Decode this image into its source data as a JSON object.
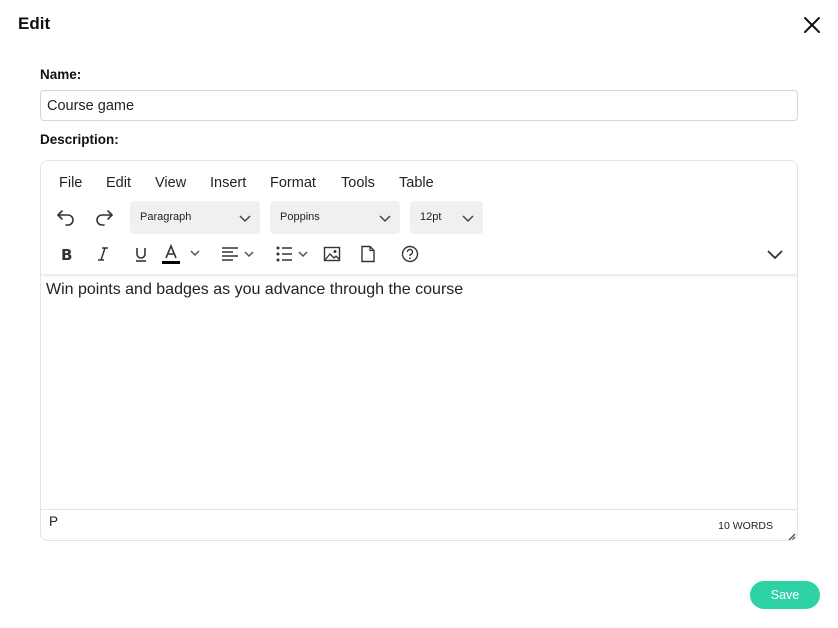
{
  "dialog": {
    "title": "Edit",
    "close_icon": "close-icon"
  },
  "name_field": {
    "label": "Name:",
    "value": "Course game"
  },
  "description_field": {
    "label": "Description:"
  },
  "editor": {
    "menus": [
      "File",
      "Edit",
      "View",
      "Insert",
      "Format",
      "Tools",
      "Table"
    ],
    "block_format": "Paragraph",
    "font_family": "Poppins",
    "font_size": "12pt",
    "icons": {
      "undo": "undo-icon",
      "redo": "redo-icon",
      "bold": "bold-icon",
      "italic": "italic-icon",
      "underline": "underline-icon",
      "text_color": "text-color-icon",
      "align": "align-left-icon",
      "list": "bullet-list-icon",
      "image": "image-icon",
      "document": "document-icon",
      "help": "help-icon",
      "more": "chevron-down-icon"
    },
    "content": "Win points and badges as you advance through the course",
    "status_path": "P",
    "word_count": "10 WORDS"
  },
  "actions": {
    "save_label": "Save"
  },
  "colors": {
    "accent": "#2ed3a5",
    "text_color_bar": "#000000"
  }
}
